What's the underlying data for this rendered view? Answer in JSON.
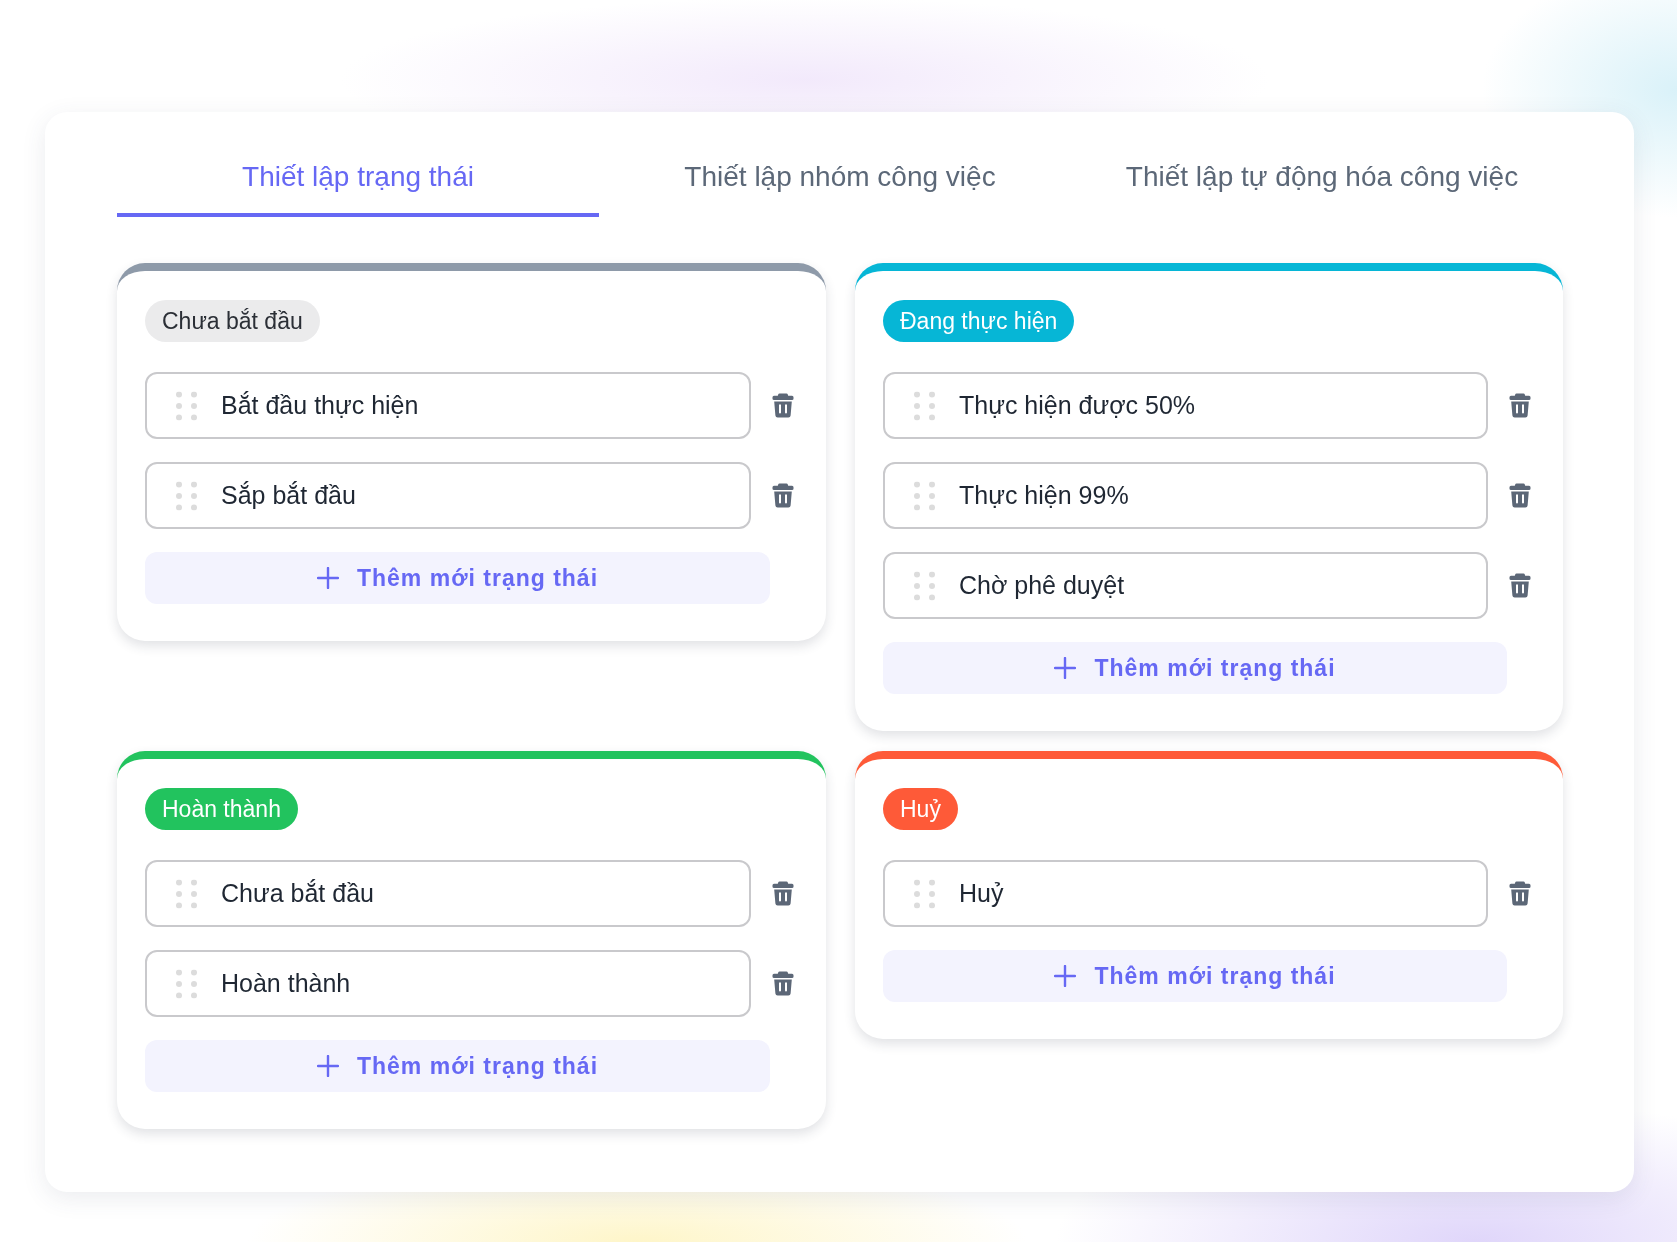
{
  "tabs": [
    {
      "label": "Thiết lập trạng thái",
      "selected": true
    },
    {
      "label": "Thiết lập nhóm công việc",
      "selected": false
    },
    {
      "label": "Thiết lập tự động hóa công việc",
      "selected": false
    }
  ],
  "status_groups": [
    {
      "name": "Chưa bắt đầu",
      "kind": "neutral",
      "color": "#8e9aa9",
      "statuses": [
        "Bắt đầu thực hiện",
        "Sắp bắt đầu"
      ],
      "add_button": "Thêm mới trạng thái"
    },
    {
      "name": "Đang thực hiện",
      "kind": "filled",
      "color": "#06b6d6",
      "statuses": [
        "Thực hiện được 50%",
        "Thực hiện 99%",
        "Chờ phê duyệt"
      ],
      "add_button": "Thêm mới trạng thái"
    },
    {
      "name": "Hoàn thành",
      "kind": "filled",
      "color": "#22c35e",
      "statuses": [
        "Chưa bắt đầu",
        "Hoàn thành"
      ],
      "add_button": "Thêm mới trạng thái"
    },
    {
      "name": "Huỷ",
      "kind": "filled",
      "color": "#fe5a38",
      "statuses": [
        "Huỷ"
      ],
      "add_button": "Thêm mới trạng thái"
    }
  ]
}
